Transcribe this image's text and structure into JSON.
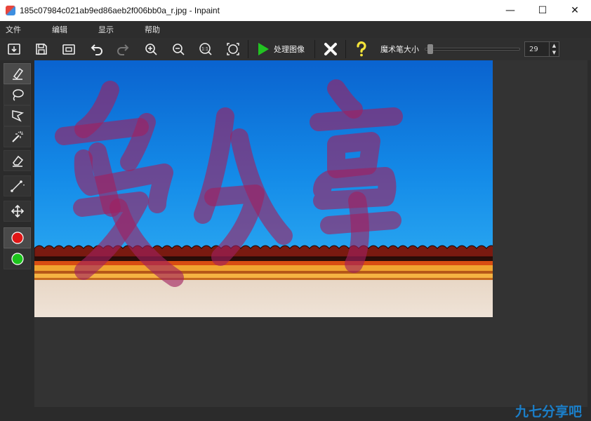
{
  "window": {
    "title": "185c07984c021ab9ed86aeb2f006bb0a_r.jpg - Inpaint",
    "minimize": "—",
    "maximize": "☐",
    "close": "✕"
  },
  "menu": [
    "文件",
    "编辑",
    "显示",
    "帮助"
  ],
  "toolbar": {
    "buttons": [
      "open-icon",
      "save-icon",
      "save-as-icon",
      "undo-icon",
      "redo-icon",
      "zoom-in-icon",
      "zoom-out-icon",
      "zoom-1to1-icon",
      "fit-icon"
    ],
    "zoom_1to1_label": "1:1",
    "process_label": "处理图像",
    "brush_size_label": "魔术笔大小",
    "brush_size_value": "29",
    "brush_size_level": 0.05,
    "colors": {
      "process": "#22c322",
      "cancel": "#ffffff",
      "help": "#f5e43a"
    }
  },
  "sidebar": {
    "tools": [
      "marker-icon",
      "lasso-icon",
      "polygon-lasso-icon",
      "magic-wand-icon",
      "eraser-icon",
      "line-icon",
      "move-icon",
      "red-color-icon",
      "green-color-icon"
    ],
    "colors": {
      "red": "#e01616",
      "green": "#1cc41c"
    }
  },
  "canvas": {
    "selection_mask_text": "爱分享",
    "mask_color": "#a02060"
  },
  "watermark": "九七分享吧"
}
